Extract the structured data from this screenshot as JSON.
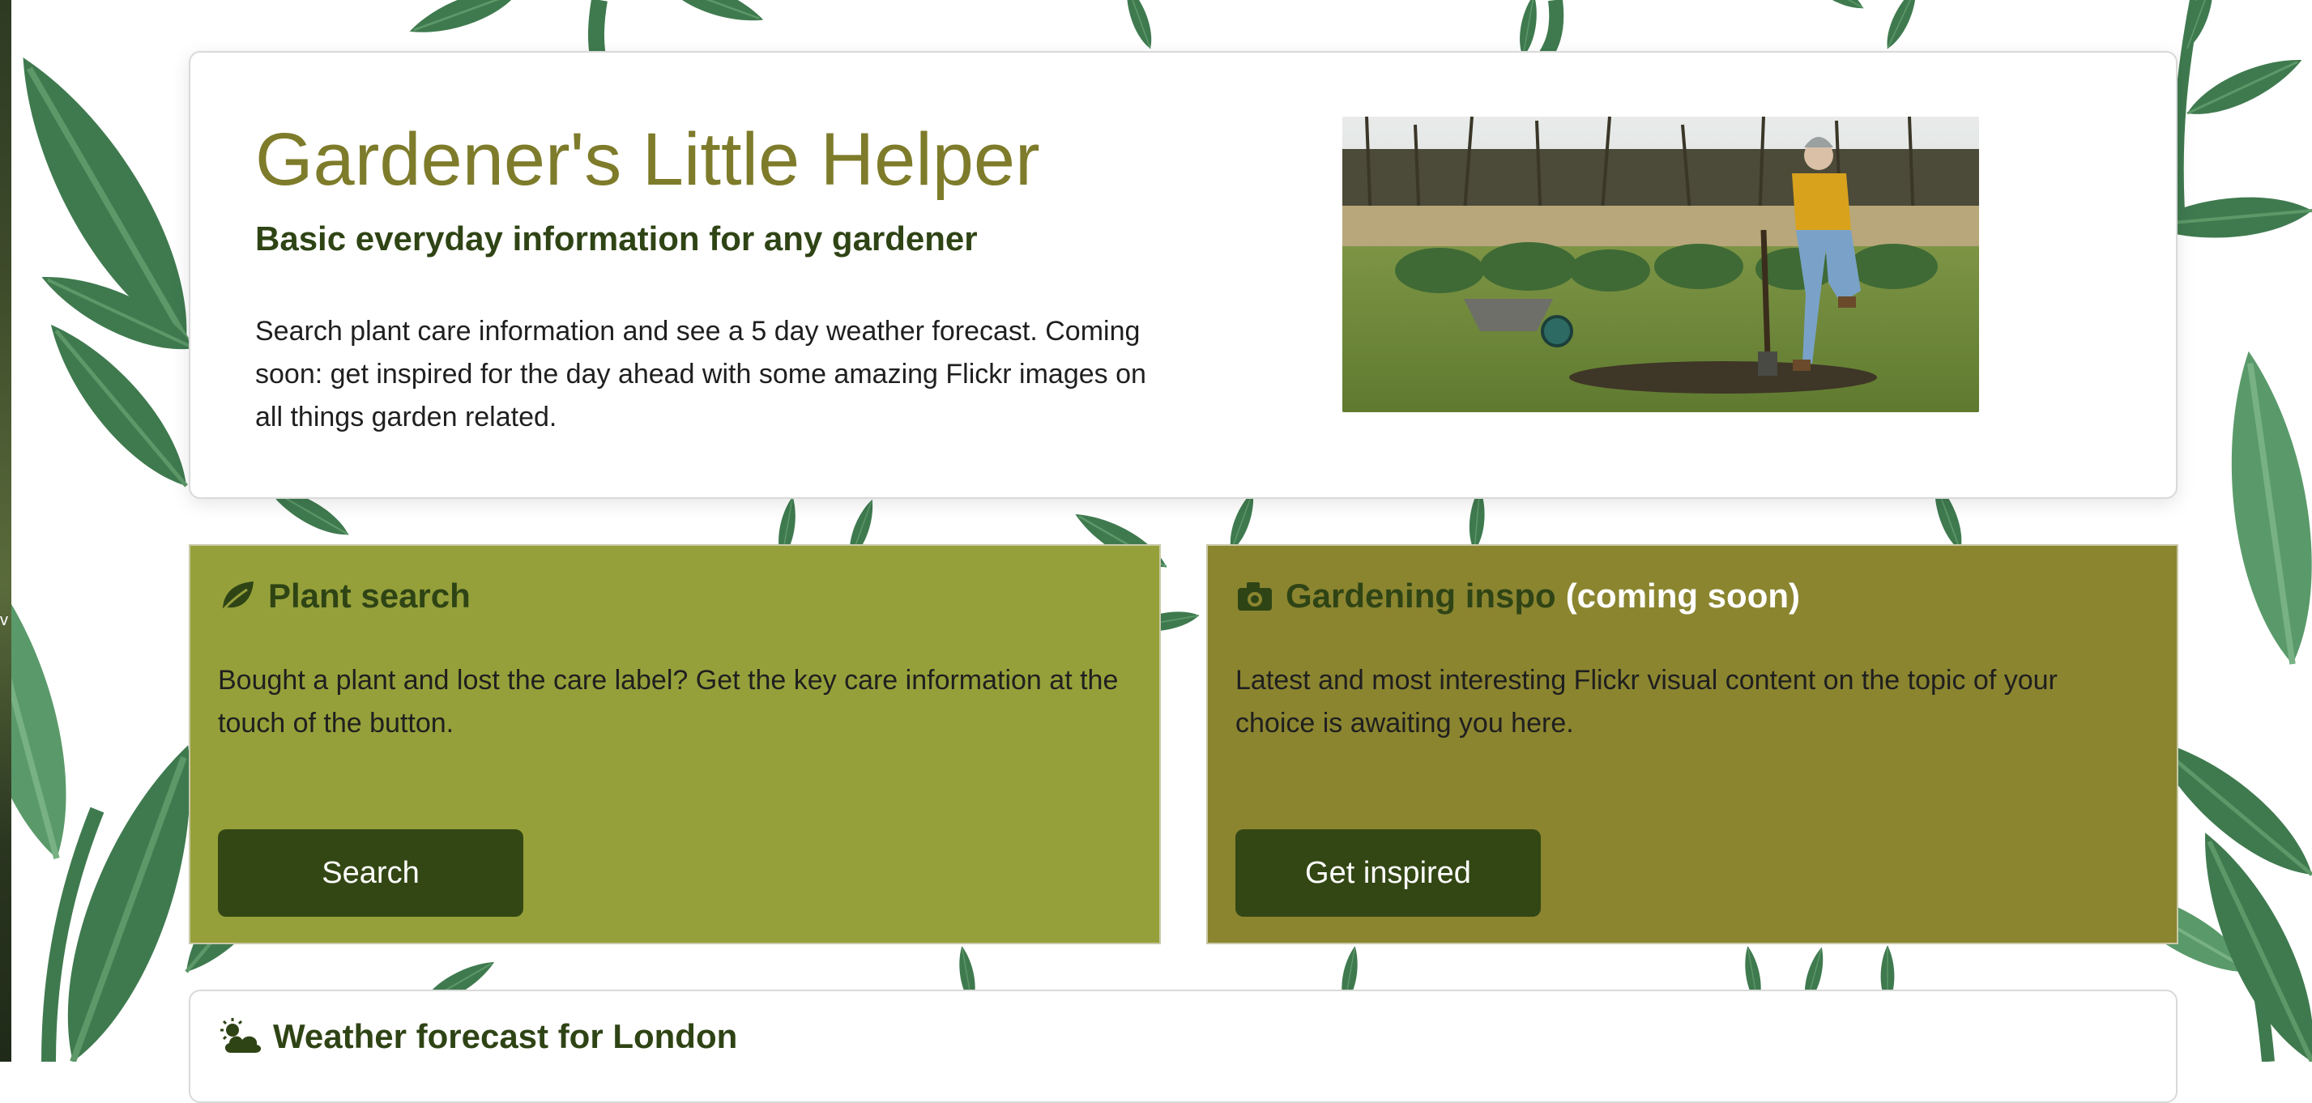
{
  "colors": {
    "title": "#7e7c2b",
    "heading": "#2f4415",
    "plant_card": "#95a03a",
    "inspo_card": "#8b8530",
    "button": "#334714",
    "leaf": "#3f7a4f"
  },
  "edge": {
    "sliver_text": "v"
  },
  "hero": {
    "title": "Gardener's Little Helper",
    "subtitle": "Basic everyday information for any gardener",
    "description": "Search plant care information and see a 5 day weather forecast. Coming soon: get inspired for the day ahead with some amazing Flickr images on all things garden related.",
    "image_icon": "gardener-photo"
  },
  "plant_card": {
    "icon": "leaf-icon",
    "heading": "Plant search",
    "text": "Bought a plant and lost the care label? Get the key care information at the touch of the button.",
    "button_label": "Search"
  },
  "inspo_card": {
    "icon": "camera-icon",
    "heading": "Gardening inspo",
    "heading_suffix": "(coming soon)",
    "text": "Latest and most interesting Flickr visual content on the topic of your choice is awaiting you here.",
    "button_label": "Get inspired"
  },
  "weather": {
    "icon": "cloud-sun-icon",
    "heading": "Weather forecast for London"
  }
}
